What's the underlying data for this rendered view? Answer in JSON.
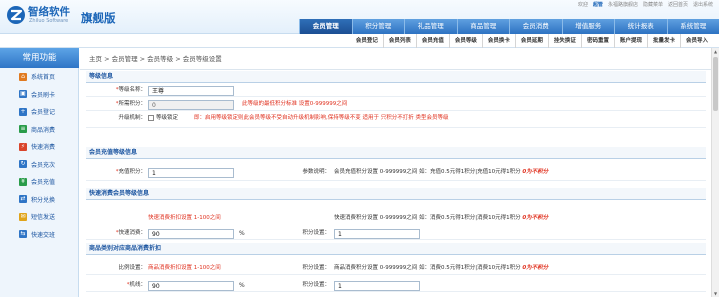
{
  "brand": {
    "name": "智络软件",
    "sub": "Zhiluo Software",
    "edition": "旗舰版",
    "accent": "#1c66b8"
  },
  "top_links": {
    "greeting": "欢迎",
    "user": "超管",
    "shop": "永福路旗舰店",
    "change_password": "隐藏菜单",
    "home": "返回首页",
    "logout": "退出系统"
  },
  "main_nav": [
    "会员管理",
    "积分管理",
    "礼品管理",
    "商品管理",
    "会员消费",
    "增值服务",
    "统计报表",
    "系统管理"
  ],
  "sub_nav": [
    "会员登记",
    "会员列表",
    "会员充值",
    "会员等级",
    "会员换卡",
    "会员延期",
    "挂失换证",
    "密码重置",
    "账户提现",
    "批量发卡",
    "会员导入"
  ],
  "sidebar": {
    "title": "常用功能",
    "items": [
      {
        "label": "系统首页",
        "icon": "home-icon",
        "color": "#e07a20"
      },
      {
        "label": "会员刷卡",
        "icon": "user-card-icon",
        "color": "#2f75c6"
      },
      {
        "label": "会员登记",
        "icon": "user-add-icon",
        "color": "#2f75c6"
      },
      {
        "label": "商品消费",
        "icon": "cart-icon",
        "color": "#2a9c4a"
      },
      {
        "label": "快速消费",
        "icon": "lightning-icon",
        "color": "#d9442b"
      },
      {
        "label": "会员充次",
        "icon": "recharge-count-icon",
        "color": "#2f75c6"
      },
      {
        "label": "会员充值",
        "icon": "recharge-icon",
        "color": "#2a9c4a"
      },
      {
        "label": "积分兑换",
        "icon": "exchange-icon",
        "color": "#2f75c6"
      },
      {
        "label": "短信发送",
        "icon": "sms-icon",
        "color": "#e0a41a"
      },
      {
        "label": "快速交班",
        "icon": "handover-icon",
        "color": "#2f75c6"
      }
    ]
  },
  "breadcrumb": "主页 > 会员管理 > 会员等级 > 会员等级设置",
  "level_info": {
    "title": "等级信息",
    "name_label": "等级名称：",
    "name_value": "王尊",
    "points_label": "所需积分：",
    "points_value": "0",
    "points_hint": "此等级的最低积分标准 设置0-999999之间",
    "upgrade_label": "升级机制：",
    "upgrade_checkbox_label": "等级锁定",
    "upgrade_hint": "即：启用等级锁定则此会员等级不受自动升级机制影响,保持等级不变 适用于 只积分不打折 类型会员等级"
  },
  "recharge": {
    "title": "会员充值等级信息",
    "ratio_label": "充值积分：",
    "ratio_value": "1",
    "param_label": "参数说明：",
    "param_note": "会员充值积分设置 0-999999之间 如：充值0.5元得1积分|充值10元得1积分",
    "param_emph": "0为不积分"
  },
  "fast_consume": {
    "title": "快速消费会员等级信息",
    "discount_hint": "快速消费折扣设置 1-100之间",
    "points_hint": "快速消费积分设置 0-999999之间 如：消费0.5元得1积分|消费10元得1积分",
    "points_emph": "0为不积分",
    "discount_label": "快速消费：",
    "discount_value": "90",
    "discount_unit": "%",
    "points_label": "积分设置：",
    "points_value": "1"
  },
  "goods_consume": {
    "title": "商品类别对应商品消费折扣",
    "ratio_label": "比例设置：",
    "discount_hint": "商品消费折扣设置 1-100之间",
    "points_label": "积分设置：",
    "points_hint": "商品消费积分设置 0-999999之间 如：消费0.5元得1积分|消费10元得1积分",
    "points_emph": "0为不积分",
    "row_label": "机线：",
    "row_discount_value": "90",
    "row_discount_unit": "%",
    "row_points_label": "积分设置：",
    "row_points_value": "1"
  }
}
